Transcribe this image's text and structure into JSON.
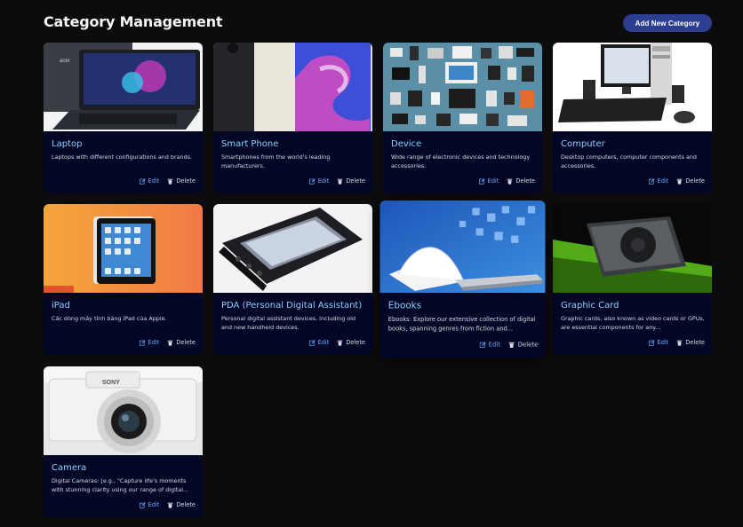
{
  "header": {
    "title": "Category Management",
    "add_button_label": "Add New Category"
  },
  "actions": {
    "edit_label": "Edit",
    "delete_label": "Delete"
  },
  "colors": {
    "background": "#0c0c0e",
    "card": "#030625",
    "title_accent": "#8fd0ff",
    "edit_accent": "#6aaaf7",
    "button": "#2d3e92"
  },
  "categories": [
    {
      "name": "Laptop",
      "description": "Laptops with different configurations and brands."
    },
    {
      "name": "Smart Phone",
      "description": "Smartphones from the world's leading manufacturers."
    },
    {
      "name": "Device",
      "description": "Wide range of electronic devices and technology accessories."
    },
    {
      "name": "Computer",
      "description": "Desktop computers, computer components and accessories."
    },
    {
      "name": "iPad",
      "description": "Các dòng máy tính bảng iPad của Apple."
    },
    {
      "name": "PDA (Personal Digital Assistant)",
      "description": "Personal digital assistant devices, including old and new handheld devices."
    },
    {
      "name": "Ebooks",
      "description": "Ebooks: Explore our extensive collection of digital books, spanning genres from fiction and..."
    },
    {
      "name": "Graphic Card",
      "description": "Graphic cards, also known as video cards or GPUs, are essential components for any..."
    },
    {
      "name": "Camera",
      "description": "Digital Cameras: [e.g., \"Capture life's moments with stunning clarity using our range of digital..."
    }
  ],
  "image_labels": {
    "laptop_brand": "acer",
    "camera_brand": "SONY"
  }
}
